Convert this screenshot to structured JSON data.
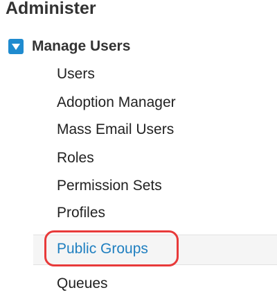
{
  "section": {
    "title": "Administer"
  },
  "group": {
    "label": "Manage Users",
    "expanded": true,
    "toggle_color": "#1f8bcf"
  },
  "items": [
    {
      "label": "Users"
    },
    {
      "label": "Adoption Manager"
    },
    {
      "label": "Mass Email Users"
    },
    {
      "label": "Roles"
    },
    {
      "label": "Permission Sets"
    },
    {
      "label": "Profiles"
    },
    {
      "label": "Public Groups",
      "selected": true
    },
    {
      "label": "Queues"
    }
  ],
  "colors": {
    "selected_text": "#1f7fc0",
    "annotation": "#e83a3a"
  }
}
